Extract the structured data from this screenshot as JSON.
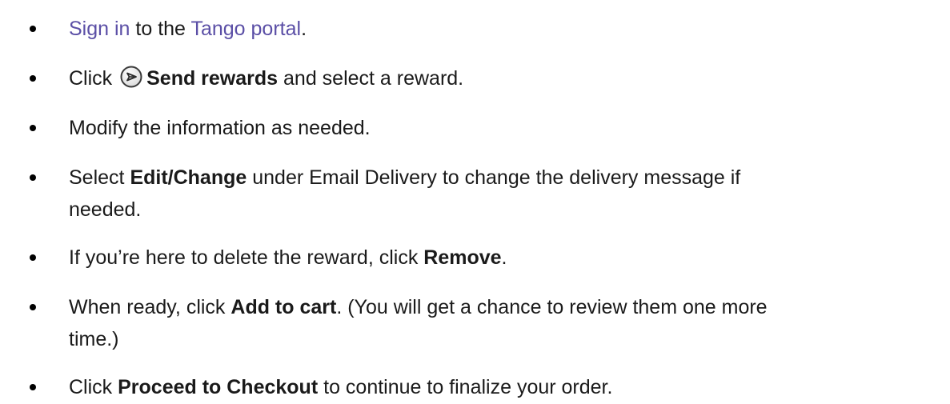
{
  "steps": [
    {
      "link1": "Sign in",
      "text1": " to the ",
      "link2": "Tango portal",
      "text2": "."
    },
    {
      "text1": "Click ",
      "icon": "send-rewards-icon",
      "bold": "Send rewards",
      "text2": " and select a reward."
    },
    {
      "text": "Modify the information as needed."
    },
    {
      "text1": "Select ",
      "bold": "Edit/Change",
      "text2": " under Email Delivery to change the delivery message if",
      "line2": "needed."
    },
    {
      "text1": "If you’re here to delete the reward, click ",
      "bold": "Remove",
      "text2": "."
    },
    {
      "text1": "When ready, click ",
      "bold": "Add to cart",
      "text2": ". (You will get a chance to review them one more",
      "line2": "time.)"
    },
    {
      "text1": "Click ",
      "bold": "Proceed to Checkout",
      "text2": " to continue to finalize your order."
    }
  ]
}
